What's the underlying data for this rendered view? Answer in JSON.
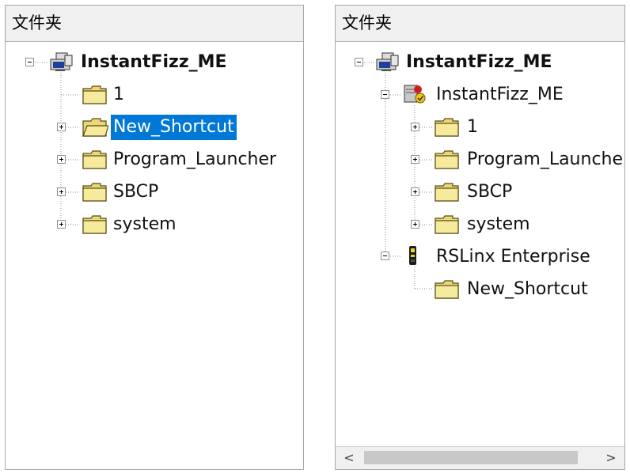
{
  "left_panel": {
    "header": "文件夹",
    "nodes": [
      {
        "label": "InstantFizz_ME",
        "icon": "project-icon",
        "expanded": true
      },
      {
        "label": "1",
        "icon": "folder-icon"
      },
      {
        "label": "New_Shortcut",
        "icon": "folder-open-icon",
        "selected": true
      },
      {
        "label": "Program_Launcher",
        "icon": "folder-icon"
      },
      {
        "label": "SBCP",
        "icon": "folder-icon"
      },
      {
        "label": "system",
        "icon": "folder-icon"
      }
    ]
  },
  "right_panel": {
    "header": "文件夹",
    "nodes": [
      {
        "label": "InstantFizz_ME",
        "icon": "project-icon",
        "expanded": true
      },
      {
        "label": "InstantFizz_ME",
        "icon": "application-server-icon",
        "expanded": true
      },
      {
        "label": "1",
        "icon": "folder-icon"
      },
      {
        "label": "Program_Launche",
        "icon": "folder-icon"
      },
      {
        "label": "SBCP",
        "icon": "folder-icon"
      },
      {
        "label": "system",
        "icon": "folder-icon"
      },
      {
        "label": "RSLinx Enterprise",
        "icon": "rslinx-icon",
        "expanded": true
      },
      {
        "label": "New_Shortcut",
        "icon": "folder-icon"
      }
    ],
    "scrollbar": {
      "left_arrow": "<",
      "right_arrow": ">"
    }
  },
  "colors": {
    "selection": "#0078d7",
    "folder": "#f2e48c",
    "header_bg": "#f0f0f0"
  }
}
